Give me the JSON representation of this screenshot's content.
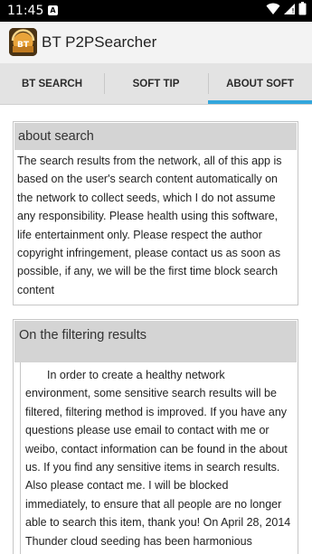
{
  "status_bar": {
    "time": "11:45",
    "notification_glyph": "A",
    "icons": [
      "wifi-icon",
      "cellular-signal-icon",
      "battery-icon"
    ]
  },
  "app_bar": {
    "logo_text": "BT",
    "title": "BT P2PSearcher"
  },
  "tabs": [
    {
      "label": "BT SEARCH",
      "active": false
    },
    {
      "label": "SOFT TIP",
      "active": false
    },
    {
      "label": "ABOUT SOFT",
      "active": true
    }
  ],
  "colors": {
    "accent": "#33a6dc",
    "tab_background": "#e3e3e3",
    "card_header": "#d4d4d4",
    "logo_orange": "#e8a33a"
  },
  "sections": [
    {
      "title": "about search",
      "body": "The search results from the network, all of this app is based on the user's search content automatically on the network to collect seeds, which I do not assume any responsibility. Please health using this software, life entertainment only. Please respect the author copyright infringement, please contact us as soon as possible, if any, we will be the first time block search content"
    },
    {
      "title": "On the filtering results",
      "body": "In order to create a healthy network environment, some sensitive search results will be filtered, filtering method is improved. If you have any questions please use email to contact with me or weibo, contact information can be found in the about us. If you find any sensitive items in search results. Also please contact me. I will be blocked immediately, to ensure that all people are no longer able to search this item, thank you! On April 28, 2014 Thunder cloud seeding has been harmonious"
    }
  ]
}
